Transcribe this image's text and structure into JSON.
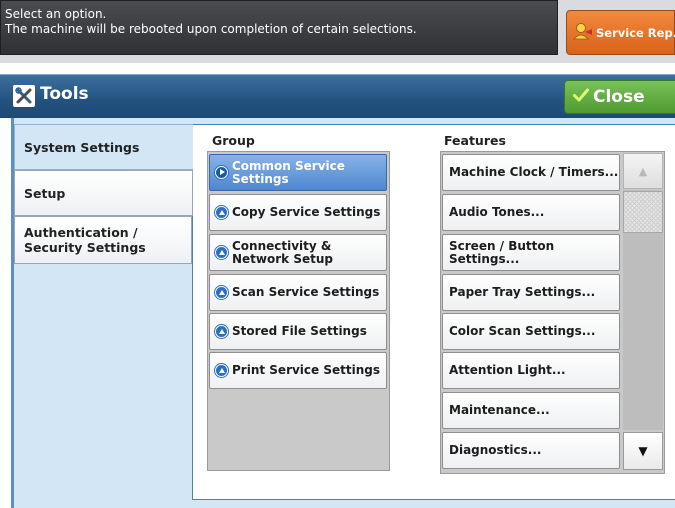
{
  "message": {
    "line1": "Select an option.",
    "line2": "The machine will be rebooted upon completion of certain selections."
  },
  "header": {
    "service_label": "Service Rep.",
    "title": "Tools",
    "close_label": "Close"
  },
  "tabs": [
    {
      "label": "System Settings"
    },
    {
      "label": "Setup"
    },
    {
      "label": "Authentication / Security Settings"
    }
  ],
  "group": {
    "heading": "Group",
    "items": [
      {
        "label": "Common Service Settings"
      },
      {
        "label": "Copy Service Settings"
      },
      {
        "label": "Connectivity & Network Setup"
      },
      {
        "label": "Scan Service Settings"
      },
      {
        "label": "Stored File Settings"
      },
      {
        "label": "Print Service Settings"
      }
    ]
  },
  "features": {
    "heading": "Features",
    "items": [
      {
        "label": "Machine Clock / Timers..."
      },
      {
        "label": "Audio Tones..."
      },
      {
        "label": "Screen / Button Settings..."
      },
      {
        "label": "Paper Tray Settings..."
      },
      {
        "label": "Color Scan Settings..."
      },
      {
        "label": "Attention Light..."
      },
      {
        "label": "Maintenance..."
      },
      {
        "label": "Diagnostics..."
      }
    ]
  },
  "icons": {
    "service": "service-rep-icon",
    "tools": "tools-icon",
    "close": "checkmark-icon",
    "scroll_up": "scroll-up-arrow-icon",
    "scroll_down": "scroll-down-arrow-icon"
  },
  "colors": {
    "service_button": "#e8772a",
    "close_button": "#5faa3e",
    "title_bar": "#23527f",
    "selected_group": "#5b91d6"
  }
}
